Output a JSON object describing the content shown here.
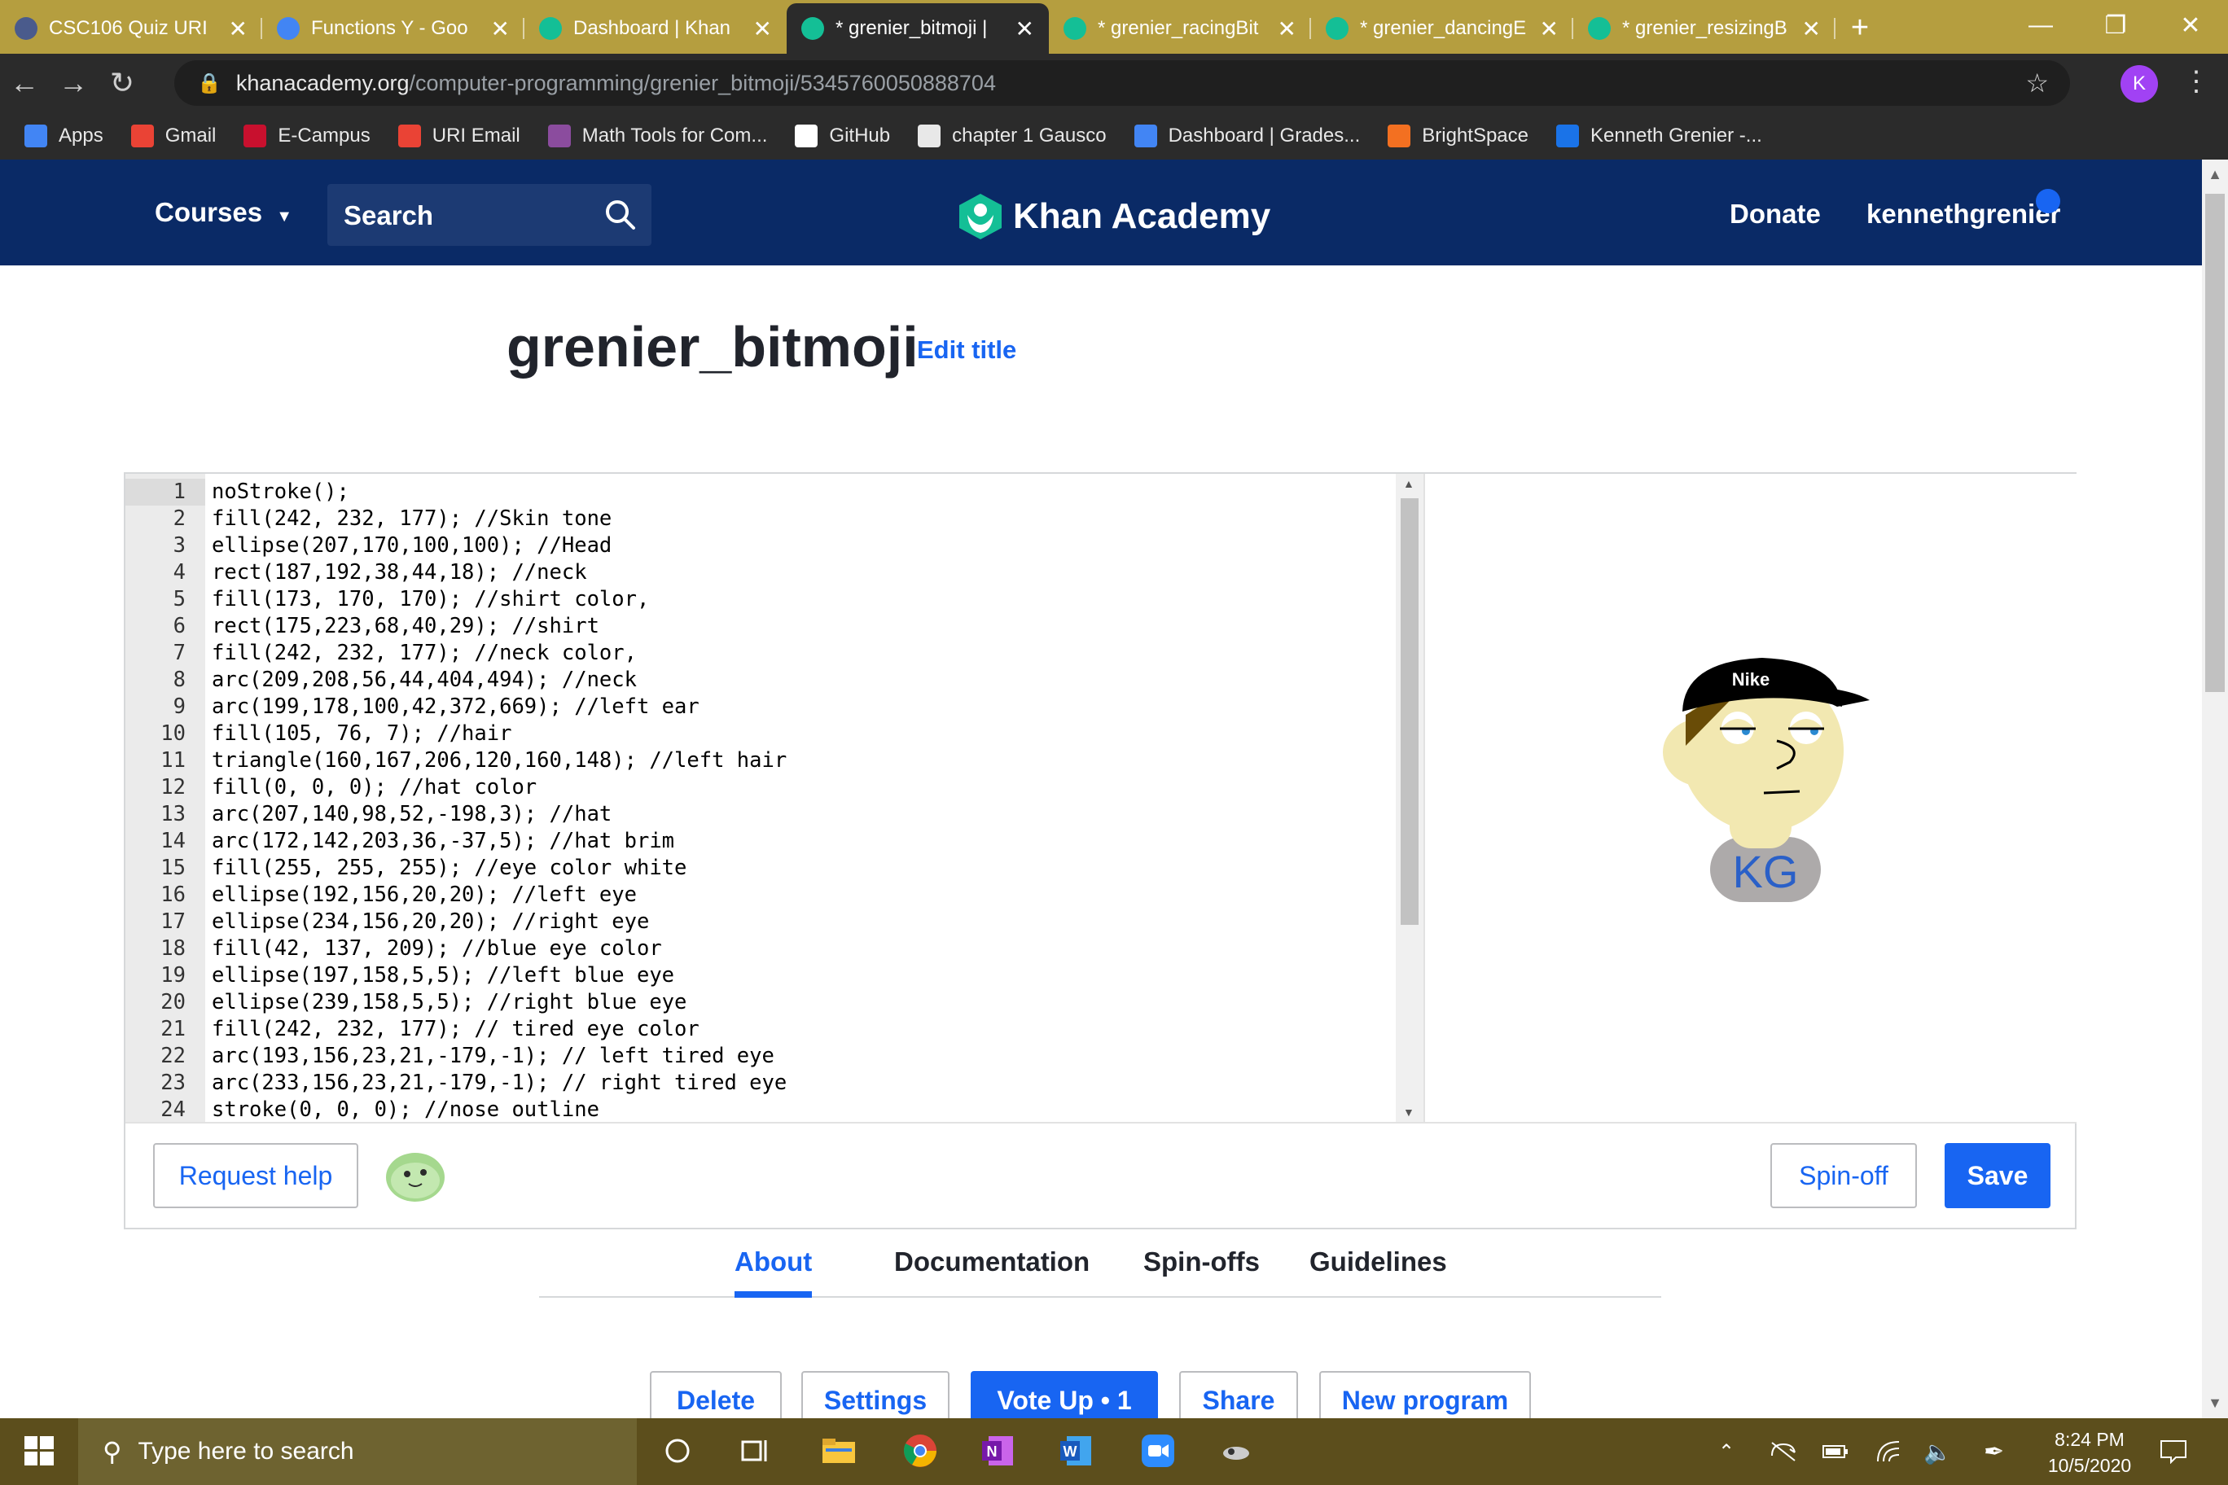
{
  "browser": {
    "tabs": [
      {
        "title": "CSC106 Quiz URI",
        "icon": "quiz-icon",
        "color": "#4a5b8c"
      },
      {
        "title": "Functions Y - Goo",
        "icon": "docs-icon",
        "color": "#4285f4"
      },
      {
        "title": "Dashboard | Khan",
        "icon": "khan-icon",
        "color": "#14bf96"
      },
      {
        "title": "* grenier_bitmoji |",
        "icon": "khan-icon",
        "color": "#14bf96"
      },
      {
        "title": "* grenier_racingBit",
        "icon": "khan-icon",
        "color": "#14bf96"
      },
      {
        "title": "* grenier_dancingE",
        "icon": "khan-icon",
        "color": "#14bf96"
      },
      {
        "title": "* grenier_resizingB",
        "icon": "khan-icon",
        "color": "#14bf96"
      }
    ],
    "active_tab": 3,
    "url_host": "khanacademy.org",
    "url_path": "/computer-programming/grenier_bitmoji/5345760050888704",
    "profile_initial": "K",
    "bookmarks": [
      {
        "label": "Apps",
        "icon": "apps-icon",
        "color": "#4285f4"
      },
      {
        "label": "Gmail",
        "icon": "gmail-icon",
        "color": "#ea4335"
      },
      {
        "label": "E-Campus",
        "icon": "ecampus-icon",
        "color": "#c8102e"
      },
      {
        "label": "URI Email",
        "icon": "mail-icon",
        "color": "#ea4335"
      },
      {
        "label": "Math Tools for Com...",
        "icon": "math-icon",
        "color": "#8b4c9e"
      },
      {
        "label": "GitHub",
        "icon": "github-icon",
        "color": "#ffffff"
      },
      {
        "label": "chapter 1 Gausco",
        "icon": "globe-icon",
        "color": "#e8e8e8"
      },
      {
        "label": "Dashboard | Grades...",
        "icon": "chart-icon",
        "color": "#4285f4"
      },
      {
        "label": "BrightSpace",
        "icon": "brightspace-icon",
        "color": "#f37021"
      },
      {
        "label": "Kenneth Grenier -...",
        "icon": "k-icon",
        "color": "#1a73e8"
      }
    ]
  },
  "header": {
    "courses": "Courses",
    "search": "Search",
    "logo": "Khan Academy",
    "donate": "Donate",
    "username": "kennethgrenier"
  },
  "program": {
    "title": "grenier_bitmoji",
    "edit_title": "Edit title"
  },
  "code": [
    "noStroke();",
    "fill(242, 232, 177); //Skin tone",
    "ellipse(207,170,100,100); //Head",
    "rect(187,192,38,44,18); //neck",
    "fill(173, 170, 170); //shirt color,",
    "rect(175,223,68,40,29); //shirt",
    "fill(242, 232, 177); //neck color,",
    "arc(209,208,56,44,404,494); //neck",
    "arc(199,178,100,42,372,669); //left ear",
    "fill(105, 76, 7); //hair",
    "triangle(160,167,206,120,160,148); //left hair",
    "fill(0, 0, 0); //hat color",
    "arc(207,140,98,52,-198,3); //hat",
    "arc(172,142,203,36,-37,5); //hat brim",
    "fill(255, 255, 255); //eye color white",
    "ellipse(192,156,20,20); //left eye",
    "ellipse(234,156,20,20); //right eye",
    "fill(42, 137, 209); //blue eye color",
    "ellipse(197,158,5,5); //left blue eye",
    "ellipse(239,158,5,5); //right blue eye",
    "fill(242, 232, 177); // tired eye color",
    "arc(193,156,23,21,-179,-1); // left tired eye",
    "arc(233,156,23,21,-179,-1); // right tired eye",
    "stroke(0, 0, 0); //nose outline"
  ],
  "canvas": {
    "hat_text": "Nike",
    "shirt_text": "KG"
  },
  "editor_footer": {
    "request_help": "Request help",
    "spinoff": "Spin-off",
    "save": "Save"
  },
  "page_tabs": [
    "About",
    "Documentation",
    "Spin-offs",
    "Guidelines"
  ],
  "active_page_tab": "About",
  "actions": {
    "delete": "Delete",
    "settings": "Settings",
    "vote_up": "Vote Up • 1",
    "share": "Share",
    "new_program": "New program"
  },
  "taskbar": {
    "search_placeholder": "Type here to search",
    "time": "8:24 PM",
    "date": "10/5/2020"
  },
  "colors": {
    "khan_blue": "#1865f2",
    "khan_header": "#0a2a66",
    "khan_green": "#14bf96"
  }
}
